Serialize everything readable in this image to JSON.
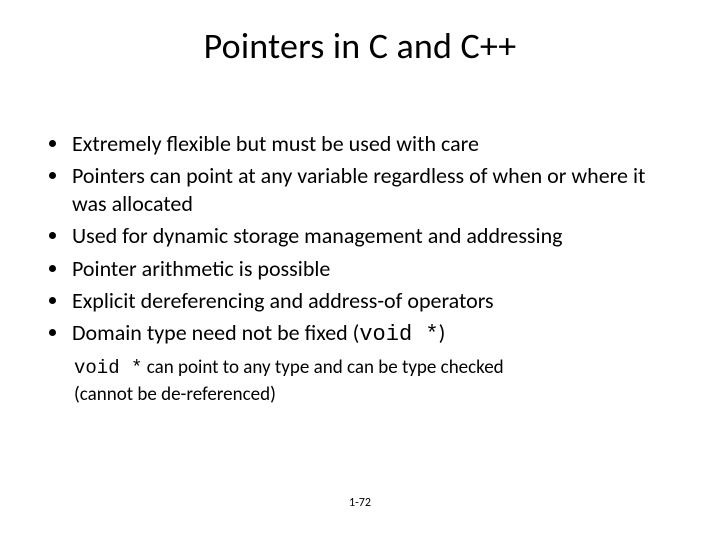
{
  "title": "Pointers in C and C++",
  "bullets": [
    "Extremely flexible but must be used with care",
    "Pointers can point at any variable regardless of when or where it was allocated",
    "Used for dynamic storage management and addressing",
    "Pointer arithmetic is possible",
    "Explicit dereferencing and address-of operators"
  ],
  "bullet_last_pre": "Domain type need not be fixed (",
  "bullet_last_code": "void *",
  "bullet_last_post": ")",
  "subnote_code": "void *",
  "subnote_rest": " can point to any type and can be type checked (cannot be de-referenced)",
  "page": "1-72"
}
